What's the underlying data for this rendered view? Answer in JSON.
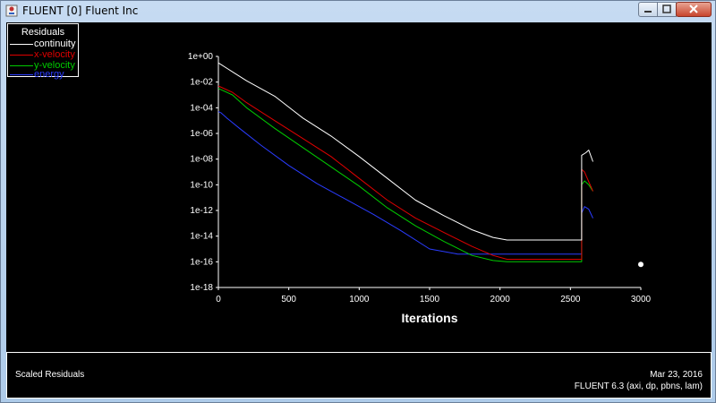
{
  "window": {
    "title": "FLUENT [0] Fluent Inc"
  },
  "footer": {
    "caption": "Scaled Residuals",
    "date": "Mar 23, 2016",
    "version": "FLUENT 6.3 (axi, dp, pbns, lam)"
  },
  "colors": {
    "continuity": "#ffffff",
    "x-velocity": "#e00000",
    "y-velocity": "#00cc00",
    "energy": "#2a3cff",
    "background": "#000000"
  },
  "chart_data": {
    "type": "line",
    "title": "",
    "legend_title": "Residuals",
    "legend_position": "top-left",
    "xlabel": "Iterations",
    "ylabel": "",
    "xlim": [
      0,
      3000
    ],
    "ylim_log10": [
      -18,
      0
    ],
    "yscale": "log",
    "grid": false,
    "x_ticks": [
      "0",
      "500",
      "1000",
      "1500",
      "2000",
      "2500",
      "3000"
    ],
    "y_ticks": [
      "1e+00",
      "1e-02",
      "1e-04",
      "1e-06",
      "1e-08",
      "1e-10",
      "1e-12",
      "1e-14",
      "1e-16",
      "1e-18"
    ],
    "series": [
      {
        "name": "continuity",
        "x": [
          0,
          100,
          200,
          400,
          600,
          800,
          1000,
          1200,
          1400,
          1600,
          1800,
          1950,
          2050,
          2200,
          2400,
          2580,
          2580,
          2610,
          2630,
          2660
        ],
        "log10_y": [
          -0.5,
          -1.2,
          -1.9,
          -3.1,
          -4.8,
          -6.2,
          -7.8,
          -9.5,
          -11.2,
          -12.4,
          -13.5,
          -14.1,
          -14.3,
          -14.3,
          -14.3,
          -14.3,
          -7.7,
          -7.5,
          -7.3,
          -8.2
        ]
      },
      {
        "name": "x-velocity",
        "x": [
          0,
          100,
          200,
          400,
          600,
          800,
          1000,
          1200,
          1400,
          1600,
          1800,
          1950,
          2050,
          2200,
          2400,
          2580,
          2580,
          2600,
          2620,
          2660
        ],
        "log10_y": [
          -2.3,
          -2.8,
          -3.6,
          -5.0,
          -6.4,
          -7.8,
          -9.5,
          -11.2,
          -12.6,
          -13.7,
          -14.8,
          -15.5,
          -15.8,
          -15.8,
          -15.8,
          -15.8,
          -8.8,
          -9.0,
          -9.5,
          -10.5
        ]
      },
      {
        "name": "y-velocity",
        "x": [
          0,
          100,
          200,
          400,
          600,
          800,
          1000,
          1200,
          1400,
          1600,
          1800,
          1950,
          2050,
          2200,
          2400,
          2580,
          2580,
          2600,
          2630,
          2660
        ],
        "log10_y": [
          -2.5,
          -3.0,
          -4.0,
          -5.6,
          -7.1,
          -8.6,
          -10.1,
          -11.8,
          -13.2,
          -14.4,
          -15.5,
          -15.9,
          -16.0,
          -16.0,
          -16.0,
          -16.0,
          -10.0,
          -9.7,
          -10.0,
          -10.5
        ]
      },
      {
        "name": "energy",
        "x": [
          0,
          20,
          60,
          150,
          300,
          500,
          700,
          900,
          1100,
          1300,
          1500,
          1700,
          1900,
          2100,
          2300,
          2500,
          2580,
          2580,
          2600,
          2630,
          2660
        ],
        "log10_y": [
          -4.3,
          -4.4,
          -4.8,
          -5.6,
          -6.9,
          -8.5,
          -9.9,
          -11.1,
          -12.3,
          -13.6,
          -15.0,
          -15.4,
          -15.4,
          -15.4,
          -15.4,
          -15.4,
          -15.4,
          -12.2,
          -11.7,
          -11.9,
          -12.6
        ]
      }
    ],
    "annotations": [
      {
        "type": "point",
        "x": 3000,
        "log10_y": -16.2
      }
    ]
  }
}
